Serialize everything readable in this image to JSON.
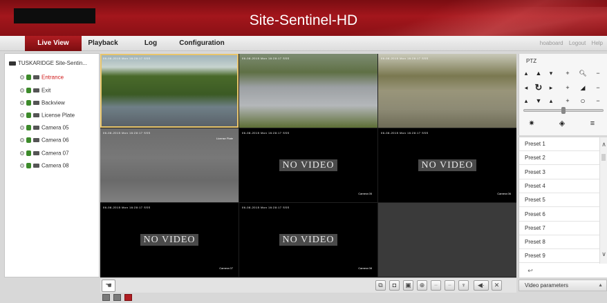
{
  "app": {
    "title": "Site-Sentinel-HD"
  },
  "nav": {
    "tabs": [
      "Live View",
      "Playback",
      "Log",
      "Configuration"
    ],
    "links": [
      "hoaboard",
      "Logout",
      "Help"
    ]
  },
  "tree": {
    "root": "TUSKARIDGE Site-Sentin...",
    "cameras": [
      "Entrance",
      "Exit",
      "Backview",
      "License Plate",
      "Camera 05",
      "Camera 06",
      "Camera 07",
      "Camera 08"
    ],
    "selected": "Entrance"
  },
  "tiles": [
    {
      "type": "image",
      "scene": "parking",
      "name": ""
    },
    {
      "type": "image",
      "scene": "road",
      "name": ""
    },
    {
      "type": "image",
      "scene": "road-night",
      "name": ""
    },
    {
      "type": "image",
      "scene": "gray",
      "name": "License Plate"
    },
    {
      "type": "novideo",
      "text": "NO VIDEO",
      "name": "Camera 05"
    },
    {
      "type": "novideo",
      "text": "NO VIDEO",
      "name": "Camera 06"
    },
    {
      "type": "novideo",
      "text": "NO VIDEO",
      "name": "Camera 07"
    },
    {
      "type": "novideo",
      "text": "NO VIDEO",
      "name": "Camera 08"
    },
    {
      "type": "empty"
    }
  ],
  "osd_text": "06-08-2015 Mon 16:28:17 SSS",
  "ptz": {
    "title": "PTZ"
  },
  "presets": [
    "Preset 1",
    "Preset 2",
    "Preset 3",
    "Preset 4",
    "Preset 5",
    "Preset 6",
    "Preset 7",
    "Preset 8",
    "Preset 9"
  ],
  "video_params": "Video parameters",
  "colors": {
    "brand_red": "#a3161c",
    "active_tile": "#e8c56b",
    "selected_camera": "#d01818"
  }
}
